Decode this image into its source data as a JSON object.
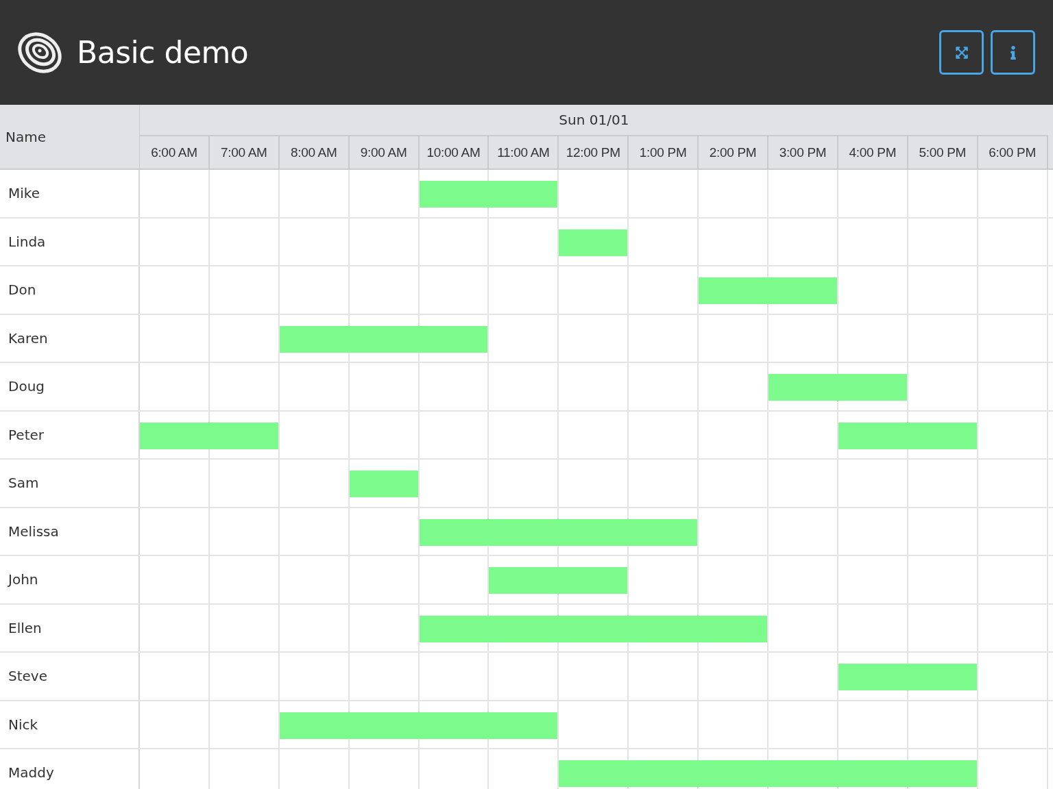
{
  "header": {
    "title": "Basic demo",
    "buttons": [
      {
        "kind": "fullscreen"
      },
      {
        "kind": "info"
      }
    ]
  },
  "timeline": {
    "name_heading": "Name",
    "date": "Sun 01/01",
    "hours": [
      "6:00 AM",
      "7:00 AM",
      "8:00 AM",
      "9:00 AM",
      "10:00 AM",
      "11:00 AM",
      "12:00 PM",
      "1:00 PM",
      "2:00 PM",
      "3:00 PM",
      "4:00 PM",
      "5:00 PM",
      "6:00 PM"
    ],
    "rows": [
      {
        "name": "Mike",
        "booked": [
          false,
          false,
          false,
          false,
          true,
          true,
          false,
          false,
          false,
          false,
          false,
          false,
          false
        ]
      },
      {
        "name": "Linda",
        "booked": [
          false,
          false,
          false,
          false,
          false,
          false,
          true,
          false,
          false,
          false,
          false,
          false,
          false
        ]
      },
      {
        "name": "Don",
        "booked": [
          false,
          false,
          false,
          false,
          false,
          false,
          false,
          false,
          true,
          true,
          false,
          false,
          false
        ]
      },
      {
        "name": "Karen",
        "booked": [
          false,
          false,
          true,
          true,
          true,
          false,
          false,
          false,
          false,
          false,
          false,
          false,
          false
        ]
      },
      {
        "name": "Doug",
        "booked": [
          false,
          false,
          false,
          false,
          false,
          false,
          false,
          false,
          false,
          true,
          true,
          false,
          false
        ]
      },
      {
        "name": "Peter",
        "booked": [
          true,
          true,
          false,
          false,
          false,
          false,
          false,
          false,
          false,
          false,
          true,
          true,
          false
        ]
      },
      {
        "name": "Sam",
        "booked": [
          false,
          false,
          false,
          true,
          false,
          false,
          false,
          false,
          false,
          false,
          false,
          false,
          false
        ]
      },
      {
        "name": "Melissa",
        "booked": [
          false,
          false,
          false,
          false,
          true,
          true,
          true,
          true,
          false,
          false,
          false,
          false,
          false
        ]
      },
      {
        "name": "John",
        "booked": [
          false,
          false,
          false,
          false,
          false,
          true,
          true,
          false,
          false,
          false,
          false,
          false,
          false
        ]
      },
      {
        "name": "Ellen",
        "booked": [
          false,
          false,
          false,
          false,
          true,
          true,
          true,
          true,
          true,
          false,
          false,
          false,
          false
        ]
      },
      {
        "name": "Steve",
        "booked": [
          false,
          false,
          false,
          false,
          false,
          false,
          false,
          false,
          false,
          false,
          true,
          true,
          false
        ]
      },
      {
        "name": "Nick",
        "booked": [
          false,
          false,
          true,
          true,
          true,
          true,
          false,
          false,
          false,
          false,
          false,
          false,
          false
        ]
      },
      {
        "name": "Maddy",
        "booked": [
          false,
          false,
          false,
          false,
          false,
          false,
          true,
          true,
          true,
          true,
          true,
          true,
          false
        ]
      }
    ]
  }
}
